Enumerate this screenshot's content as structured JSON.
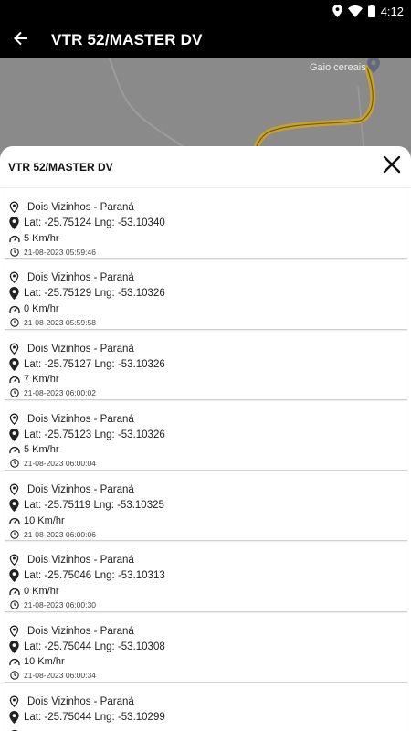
{
  "status_bar": {
    "time": "4:12",
    "icons": [
      "location-icon",
      "wifi-icon",
      "battery-icon"
    ]
  },
  "app_bar": {
    "title": "VTR 52/MASTER DV",
    "back_icon": "arrow-back-icon"
  },
  "map": {
    "place_label": "Gaio cereais",
    "route_color": "#c9a227"
  },
  "sheet": {
    "title": "VTR 52/MASTER DV",
    "close_icon": "close-icon",
    "items": [
      {
        "place": "Dois Vizinhos - Paraná",
        "coords": "Lat: -25.75124 Lng: -53.10340",
        "speed": "5 Km/hr",
        "time": "21-08-2023 05:59:46"
      },
      {
        "place": "Dois Vizinhos - Paraná",
        "coords": "Lat: -25.75129 Lng: -53.10326",
        "speed": "0 Km/hr",
        "time": "21-08-2023 05:59:58"
      },
      {
        "place": "Dois Vizinhos - Paraná",
        "coords": "Lat: -25.75127 Lng: -53.10326",
        "speed": "7 Km/hr",
        "time": "21-08-2023 06:00:02"
      },
      {
        "place": "Dois Vizinhos - Paraná",
        "coords": "Lat: -25.75123 Lng: -53.10326",
        "speed": "5 Km/hr",
        "time": "21-08-2023 06:00:04"
      },
      {
        "place": "Dois Vizinhos - Paraná",
        "coords": "Lat: -25.75119 Lng: -53.10325",
        "speed": "10 Km/hr",
        "time": "21-08-2023 06:00:06"
      },
      {
        "place": "Dois Vizinhos - Paraná",
        "coords": "Lat: -25.75046 Lng: -53.10313",
        "speed": "0 Km/hr",
        "time": "21-08-2023 06:00:30"
      },
      {
        "place": "Dois Vizinhos - Paraná",
        "coords": "Lat: -25.75044 Lng: -53.10308",
        "speed": "10 Km/hr",
        "time": "21-08-2023 06:00:34"
      },
      {
        "place": "Dois Vizinhos - Paraná",
        "coords": "Lat: -25.75044 Lng: -53.10299",
        "speed": "",
        "time": ""
      }
    ],
    "item_icons": [
      "pin-outline-icon",
      "pin-icon",
      "speedometer-icon",
      "clock-icon"
    ]
  }
}
